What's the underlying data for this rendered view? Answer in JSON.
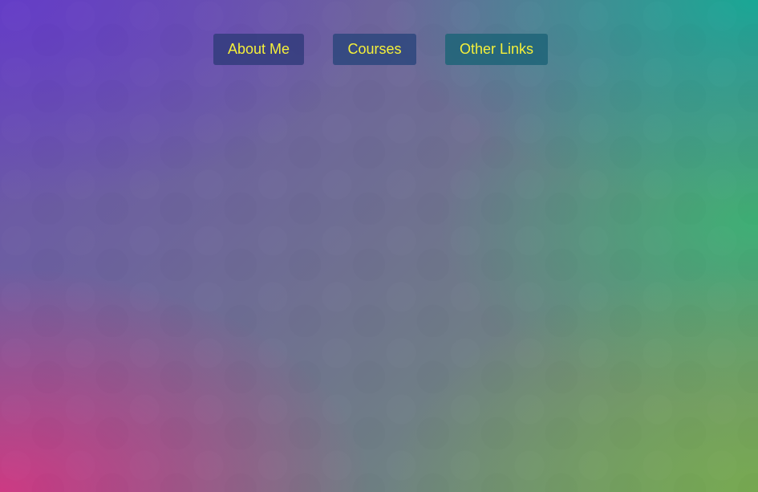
{
  "nav": {
    "items": [
      {
        "label": "About Me"
      },
      {
        "label": "Courses"
      },
      {
        "label": "Other Links"
      }
    ]
  },
  "colors": {
    "button_text": "#f5f03a",
    "bg_top_left": "#643cc8",
    "bg_top_right": "#14aa96",
    "bg_bottom_left": "#d23782",
    "bg_bottom_right": "#78aa50"
  }
}
